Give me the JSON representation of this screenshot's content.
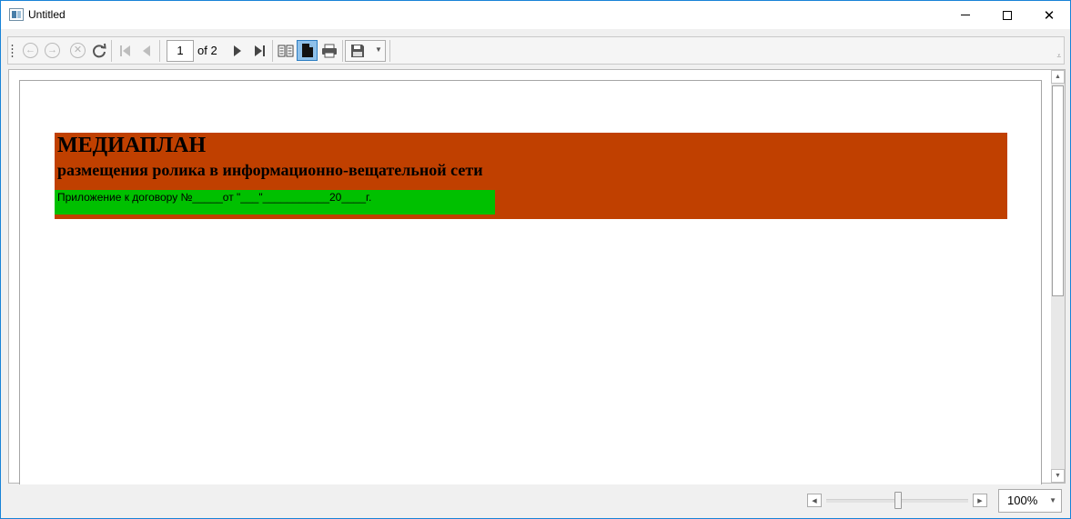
{
  "window": {
    "title": "Untitled"
  },
  "toolbar": {
    "page_number": "1",
    "page_of": "of 2"
  },
  "document": {
    "title": "МЕДИАПЛАН",
    "subtitle": "размещения ролика в информационно-вещательной сети",
    "contract_line": "Приложение к договору №_____от \"___\"___________20____г."
  },
  "statusbar": {
    "zoom": "100%"
  },
  "colors": {
    "header_band": "#c04000",
    "contract_band": "#00c000",
    "accent": "#1883d7"
  }
}
